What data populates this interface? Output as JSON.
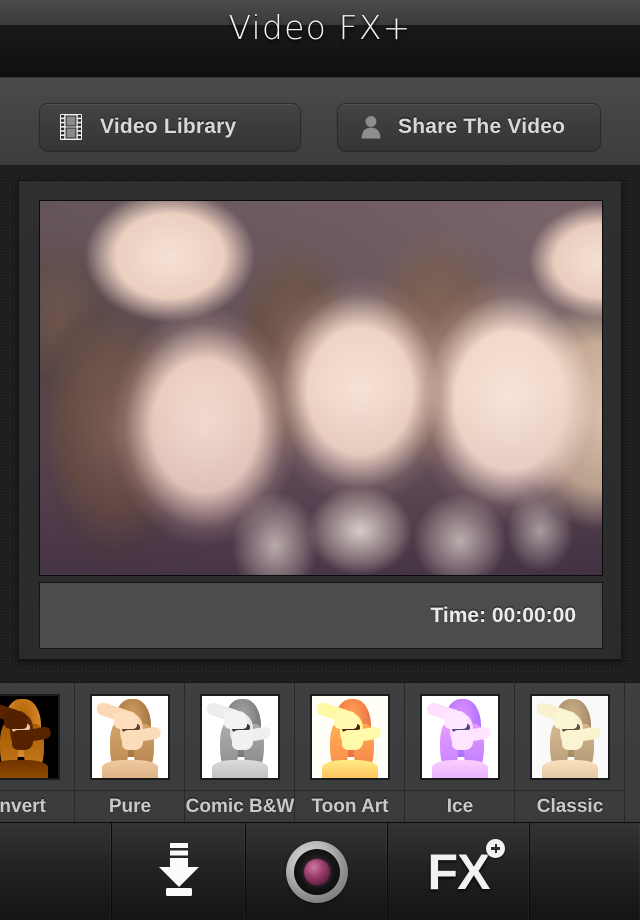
{
  "app": {
    "title": "Video FX+"
  },
  "toolbar": {
    "library_button": {
      "label": "Video Library",
      "icon": "film-strip-icon"
    },
    "share_button": {
      "label": "Share The Video",
      "icon": "person-icon"
    }
  },
  "preview": {
    "time_label": "Time: 00:00:00"
  },
  "filters": [
    {
      "label": "Invert",
      "effect": "fx-invert"
    },
    {
      "label": "Pure",
      "effect": "fx-pure"
    },
    {
      "label": "Comic B&W",
      "effect": "fx-bw"
    },
    {
      "label": "Toon Art",
      "effect": "fx-toon"
    },
    {
      "label": "Ice",
      "effect": "fx-ice"
    },
    {
      "label": "Classic",
      "effect": "fx-classic"
    }
  ],
  "bottom_bar": {
    "save_icon": "download-icon",
    "camera_icon": "camera-lens-icon",
    "fx_label": "FX",
    "fx_badge_icon": "plus-badge-icon"
  },
  "colors": {
    "background": "#262626",
    "title_bar": "#131416",
    "toolbar": "#434446",
    "button_face": "#3b3c3e",
    "text_primary": "#d8d8d8",
    "time_bar": "#4b4c4e",
    "filter_strip": "#3c3d3f",
    "bottom_bar": "#232325",
    "lens_accent": "#9e3f6e"
  }
}
